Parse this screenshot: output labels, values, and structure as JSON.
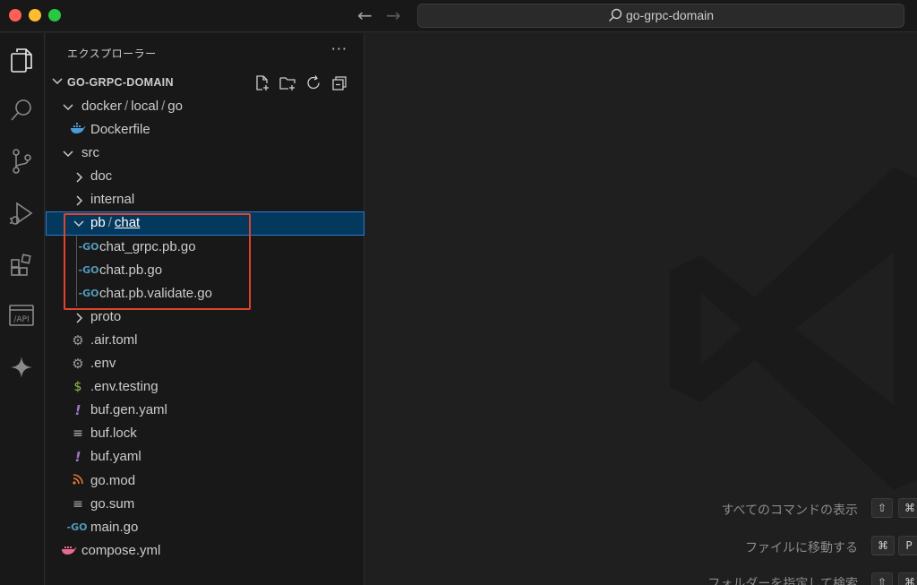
{
  "titlebar": {
    "search_text": "go-grpc-domain",
    "back_glyph": "←",
    "forward_glyph": "→"
  },
  "sidebar": {
    "title": "エクスプローラー",
    "more_glyph": "···",
    "project_title": "GO-GRPC-DOMAIN"
  },
  "tree": {
    "docker": {
      "a": "docker",
      "b": "local",
      "c": "go",
      "sep": "/"
    },
    "dockerfile": "Dockerfile",
    "src": "src",
    "doc": "doc",
    "internal": "internal",
    "pb": {
      "a": "pb",
      "b": "chat",
      "sep": "/"
    },
    "chat_grpc": "chat_grpc.pb.go",
    "chat_pb": "chat.pb.go",
    "chat_validate": "chat.pb.validate.go",
    "proto": "proto",
    "air": ".air.toml",
    "env": ".env",
    "env_testing": ".env.testing",
    "buf_gen": "buf.gen.yaml",
    "buf_lock": "buf.lock",
    "buf_yaml": "buf.yaml",
    "go_mod": "go.mod",
    "go_sum": "go.sum",
    "main_go": "main.go",
    "compose": "compose.yml"
  },
  "icons": {
    "go_glyph": "-GO",
    "gear_glyph": "⚙",
    "dollar_glyph": "$",
    "bang_glyph": "!",
    "lines_glyph": "≡",
    "rss_glyph": "ᯤ"
  },
  "activity_bar": {
    "api_label": "/API"
  },
  "editor": {
    "hint1": "すべてのコマンドの表示",
    "hint1_keys": [
      "⇧",
      "⌘"
    ],
    "hint2": "ファイルに移動する",
    "hint2_keys": [
      "⌘",
      "P"
    ],
    "hint3": "フォルダーを指定して検索",
    "hint3_keys": [
      "⇧",
      "⌘"
    ]
  },
  "colors": {
    "accent": "#2b79d0",
    "selection": "#04395e",
    "highlight_box": "#e0442a",
    "go_icon": "#519aba",
    "docker_icon": "#4d9bd6",
    "dollar_icon": "#8dc149",
    "yaml_icon": "#a074c4",
    "rss_icon": "#e37933"
  }
}
